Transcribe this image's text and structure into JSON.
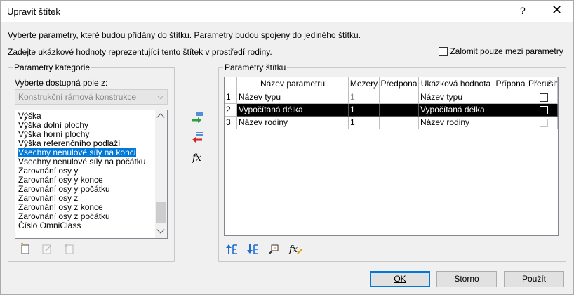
{
  "window": {
    "title": "Upravit štítek",
    "help_glyph": "?",
    "close_glyph": "✕"
  },
  "intro": {
    "line1": "Vyberte parametry, které budou přidány do štítku. Parametry budou spojeny do jediného štítku.",
    "line2": "Zadejte ukázkové hodnoty reprezentující tento štítek v prostředí rodiny.",
    "wrap_checkbox_label": "Zalomit pouze mezi parametry",
    "wrap_checked": false
  },
  "category_params": {
    "group_title": "Parametry kategorie",
    "select_label": "Vyberte dostupná pole z:",
    "select_value": "Konstrukční rámová konstrukce",
    "items": [
      "Výška",
      "Výška dolní plochy",
      "Výška horní plochy",
      "Výška referenčního podlaží",
      "Všechny nenulové síly na konci",
      "Všechny nenulové síly na počátku",
      "Zarovnání osy y",
      "Zarovnání osy y konce",
      "Zarovnání osy y počátku",
      "Zarovnání osy z",
      "Zarovnání osy z konce",
      "Zarovnání osy z počátku",
      "Číslo OmniClass"
    ],
    "selected_index": 4
  },
  "label_params": {
    "group_title": "Parametry štítku",
    "columns": [
      "Název parametru",
      "Mezery",
      "Předpona",
      "Ukázková hodnota",
      "Přípona",
      "Přerušit"
    ],
    "rows": [
      {
        "num": "1",
        "name": "Název typu",
        "spaces": "1",
        "prefix": "",
        "sample": "Název typu",
        "suffix": ""
      },
      {
        "num": "2",
        "name": "Vypočítaná délka",
        "spaces": "1",
        "prefix": "",
        "sample": "Vypočítaná délka",
        "suffix": ""
      },
      {
        "num": "3",
        "name": "Název rodiny",
        "spaces": "1",
        "prefix": "",
        "sample": "Název rodiny",
        "suffix": ""
      }
    ],
    "selected_row": 2
  },
  "mid_buttons": {
    "formula_glyph": "fx"
  },
  "buttons": {
    "ok": "OK",
    "cancel": "Storno",
    "apply": "Použít"
  },
  "colors": {
    "selection_blue": "#0078d7",
    "arrow_green": "#2e9e3e",
    "arrow_red": "#d42020",
    "icon_blue": "#1e6fd0"
  }
}
